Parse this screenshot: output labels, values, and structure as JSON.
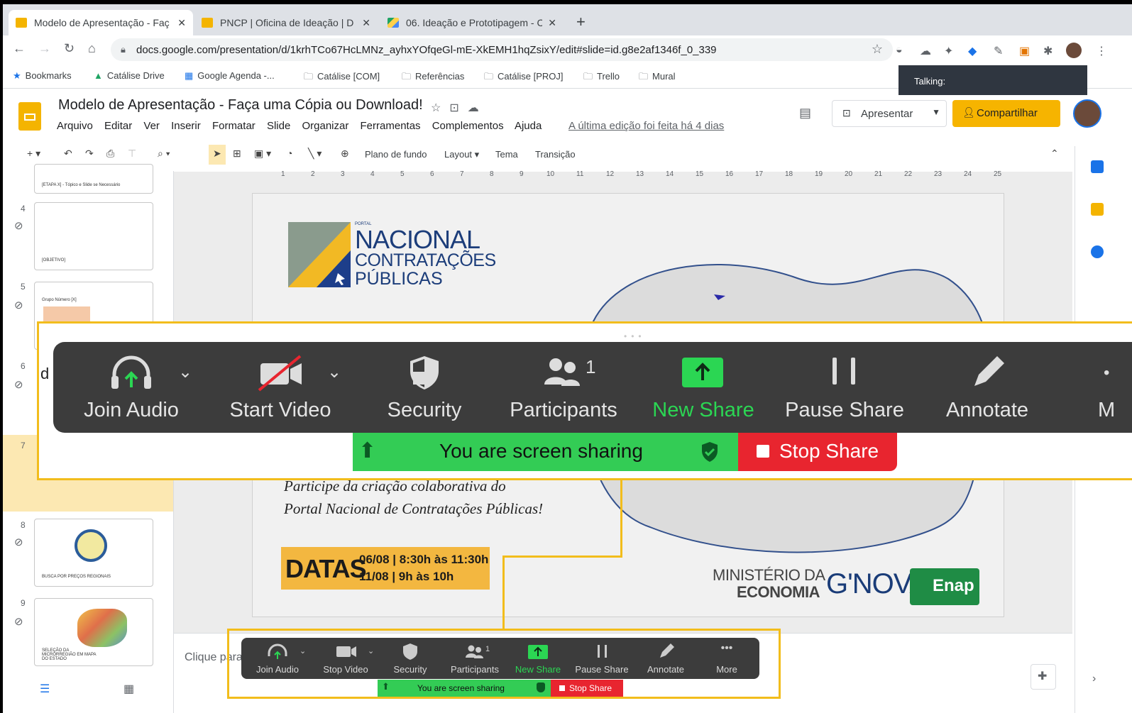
{
  "browser": {
    "tabs": [
      {
        "title": "Modelo de Apresentação - Faç",
        "color": "#f4b400"
      },
      {
        "title": "PNCP | Oficina de Ideação | D",
        "color": "#f4b400"
      },
      {
        "title": "06. Ideação e Prototipagem - C",
        "color": "#1fa463"
      }
    ],
    "new_tab": "+",
    "url": "docs.google.com/presentation/d/1krhTCo67HcLMNz_ayhxYOfqeGl-mE-XkEMH1hqZsixY/edit#slide=id.g8e2af1346f_0_339",
    "bookmarks": [
      "Bookmarks",
      "Catálise Drive",
      "Google Agenda -...",
      "Catálise [COM]",
      "Referências",
      "Catálise [PROJ]",
      "Trello",
      "Mural"
    ]
  },
  "talking": "Talking:",
  "slides_app": {
    "doc_title": "Modelo de Apresentação - Faça uma Cópia ou Download!",
    "menu": [
      "Arquivo",
      "Editar",
      "Ver",
      "Inserir",
      "Formatar",
      "Slide",
      "Organizar",
      "Ferramentas",
      "Complementos",
      "Ajuda"
    ],
    "last_edit": "A última edição foi feita há 4 dias",
    "present_label": "Apresentar",
    "share_label": "Compartilhar",
    "toolbar": {
      "background": "Plano de fundo",
      "layout": "Layout",
      "theme": "Tema",
      "transition": "Transição"
    },
    "ruler_marks": [
      "1",
      "2",
      "3",
      "4",
      "5",
      "6",
      "7",
      "8",
      "9",
      "10",
      "11",
      "12",
      "13",
      "14",
      "15",
      "16",
      "17",
      "18",
      "19",
      "20",
      "21",
      "22",
      "23",
      "24",
      "25"
    ],
    "filmstrip": [
      {
        "num": "",
        "caption": "[ETAPA X] - Tópico e Slide se Necessário"
      },
      {
        "num": "4",
        "caption": "[OBJETIVO]"
      },
      {
        "num": "5",
        "caption": "Grupo Número [X]"
      },
      {
        "num": "6",
        "caption": ""
      },
      {
        "num": "7",
        "caption": ""
      },
      {
        "num": "8",
        "caption": "BUSCA POR PREÇOS REGIONAIS"
      },
      {
        "num": "9",
        "caption": "SELEÇÃO DA MICRORREGIÃO EM MAPA DO ESTADO"
      }
    ],
    "notes_placeholder": "Clique para"
  },
  "slide": {
    "logo_small": "PORTAL",
    "logo_line1": "NACIONAL",
    "logo_line2": "CONTRATAÇÕES",
    "logo_line3": "PÚBLICAS",
    "text_line1": "Participe da criação colaborativa do",
    "text_line2": "Portal Nacional de Contratações Públicas!",
    "datas_label": "DATAS",
    "date1": "06/08 | 8:30h às 11:30h",
    "date2": "11/08 | 9h às 10h",
    "ministry1": "MINISTÉRIO DA",
    "ministry2": "ECONOMIA",
    "gnova": "G'NOVA",
    "enap": "Enap",
    "stray_text": "d"
  },
  "zoom_large": {
    "buttons": [
      "Join Audio",
      "Start Video",
      "Security",
      "Participants",
      "New Share",
      "Pause Share",
      "Annotate",
      "M"
    ],
    "participants_count": "1",
    "sharing_text": "You are screen sharing",
    "stop_label": "Stop Share"
  },
  "zoom_small": {
    "buttons": [
      "Join Audio",
      "Stop Video",
      "Security",
      "Participants",
      "New Share",
      "Pause Share",
      "Annotate",
      "More"
    ],
    "participants_count": "1",
    "sharing_text": "You are screen sharing",
    "stop_label": "Stop Share"
  },
  "colors": {
    "zoom_green": "#2bd653",
    "stop_red": "#e8252f",
    "highlight": "#f2bd1c",
    "share_yellow": "#f6b400"
  }
}
